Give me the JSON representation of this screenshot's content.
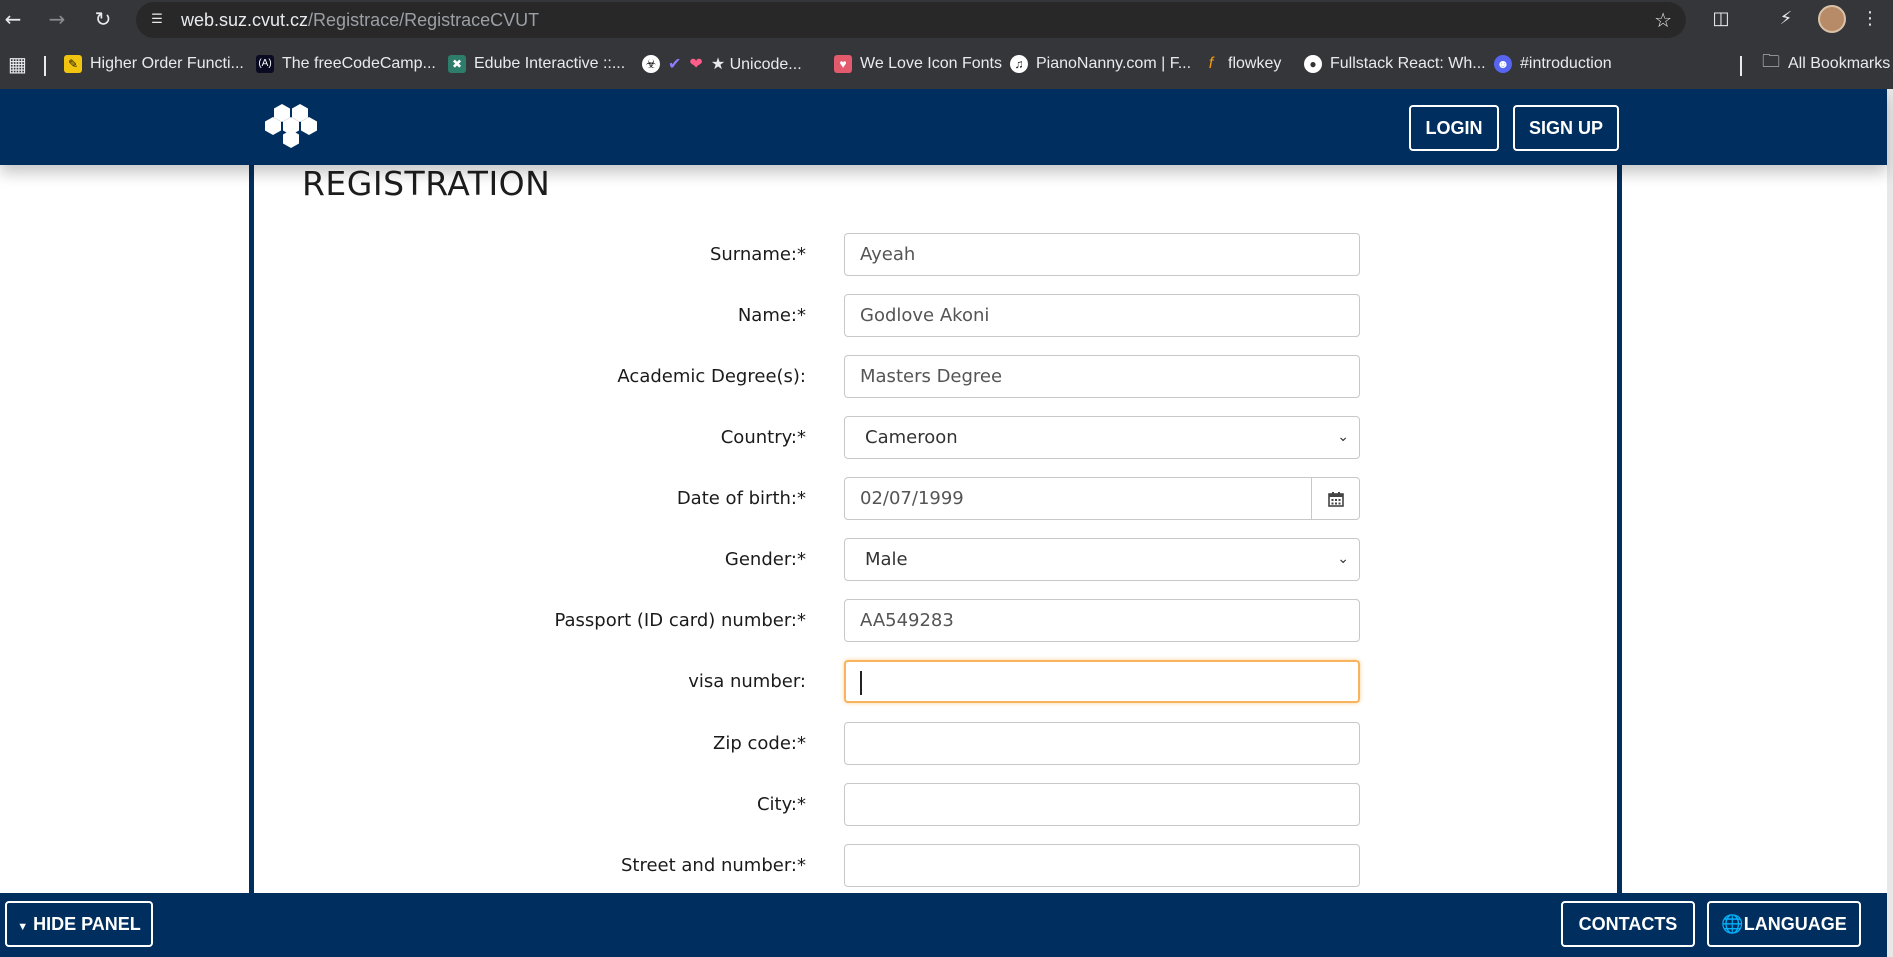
{
  "browser": {
    "url_host": "web.suz.cvut.cz",
    "url_path": "/Registrace/RegistraceCVUT",
    "bookmarks": [
      {
        "label": "Higher Order Functi...",
        "icon": "pencil-icon",
        "color": "#f1c40f"
      },
      {
        "label": "The freeCodeCamp...",
        "icon": "freecodecamp-icon",
        "color": "#0a0a23"
      },
      {
        "label": "Edube Interactive ::...",
        "icon": "edube-icon",
        "color": "#2e7d6b"
      },
      {
        "label": "★ Unicode...",
        "icon": "unicode-icon",
        "color": "#ffffff"
      },
      {
        "label": "We Love Icon Fonts",
        "icon": "heart-icon",
        "color": "#e25a6b"
      },
      {
        "label": "PianoNanny.com | F...",
        "icon": "piano-icon",
        "color": "#ffffff"
      },
      {
        "label": "flowkey",
        "icon": "flowkey-icon",
        "color": "#f39c12"
      },
      {
        "label": "Fullstack React: Wh...",
        "icon": "globe-icon",
        "color": "#ffffff"
      },
      {
        "label": "#introduction",
        "icon": "discord-icon",
        "color": "#5865f2"
      }
    ],
    "all_bookmarks_label": "All Bookmarks"
  },
  "header": {
    "login_label": "LOGIN",
    "signup_label": "SIGN UP",
    "brand_color": "#002f5f"
  },
  "page": {
    "title": "REGISTRATION"
  },
  "form": {
    "surname": {
      "label": "Surname:*",
      "value": "Ayeah"
    },
    "name": {
      "label": "Name:*",
      "value": "Godlove Akoni"
    },
    "degree": {
      "label": "Academic Degree(s):",
      "value": "Masters Degree"
    },
    "country": {
      "label": "Country:*",
      "value": "Cameroon"
    },
    "dob": {
      "label": "Date of birth:*",
      "value": "02/07/1999"
    },
    "gender": {
      "label": "Gender:*",
      "value": "Male"
    },
    "passport": {
      "label": "Passport (ID card) number:*",
      "value": "AA549283"
    },
    "visa": {
      "label": "visa number:",
      "value": ""
    },
    "zip": {
      "label": "Zip code:*",
      "value": ""
    },
    "city": {
      "label": "City:*",
      "value": ""
    },
    "street": {
      "label": "Street and number:*",
      "value": ""
    }
  },
  "footer": {
    "hide_panel_label": "HIDE PANEL",
    "contacts_label": "CONTACTS",
    "language_label": "LANGUAGE"
  }
}
